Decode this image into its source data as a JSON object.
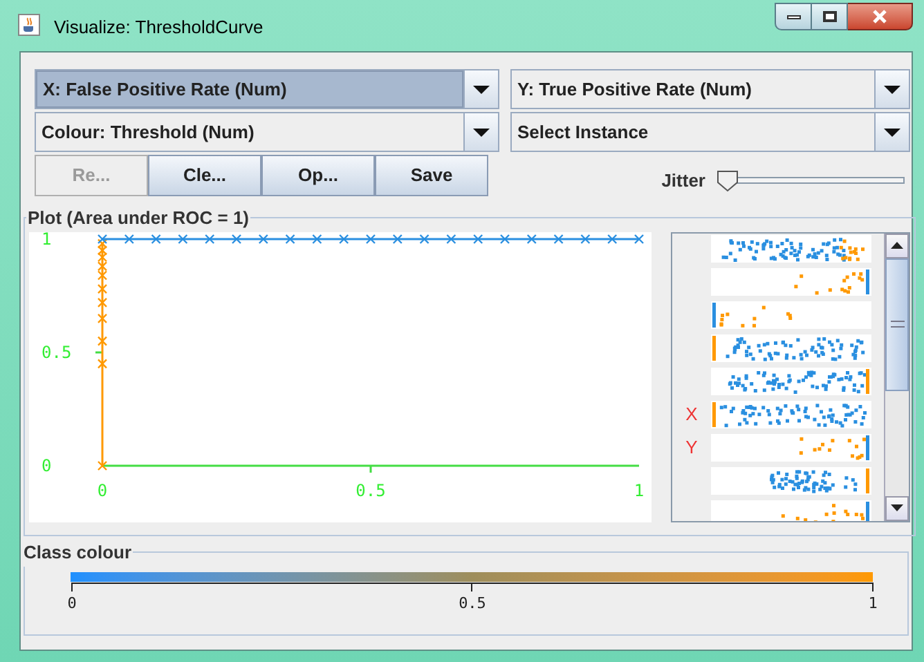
{
  "window": {
    "title": "Visualize: ThresholdCurve"
  },
  "selectors": [
    {
      "label": "X: False Positive Rate (Num)",
      "highlighted": true
    },
    {
      "label": "Y: True Positive Rate (Num)",
      "highlighted": false
    },
    {
      "label": "Colour: Threshold (Num)",
      "highlighted": false
    },
    {
      "label": "Select Instance",
      "highlighted": false
    }
  ],
  "buttons": [
    {
      "label": "Re...",
      "disabled": true
    },
    {
      "label": "Cle...",
      "disabled": false
    },
    {
      "label": "Op...",
      "disabled": false
    },
    {
      "label": "Save",
      "disabled": false
    }
  ],
  "jitter": {
    "label": "Jitter",
    "level": 0
  },
  "plot": {
    "title": "Plot (Area under ROC = 1)",
    "chart_data": {
      "type": "scatter",
      "x": [
        0,
        0,
        0,
        0,
        0,
        0,
        0,
        0,
        0,
        0,
        0,
        0,
        0.05,
        0.1,
        0.15,
        0.2,
        0.25,
        0.3,
        0.35,
        0.4,
        0.45,
        0.5,
        0.55,
        0.6,
        0.65,
        0.7,
        0.75,
        0.8,
        0.85,
        0.9,
        0.95,
        1
      ],
      "series": [
        {
          "color": "#ff9900",
          "values": [
            0,
            0.45,
            0.55,
            0.65,
            0.72,
            0.78,
            0.84,
            0.88,
            0.92,
            0.95,
            0.98,
            null,
            null,
            null,
            null,
            null,
            null,
            null,
            null,
            null,
            null,
            null,
            null,
            null,
            null,
            null,
            null,
            null,
            null,
            null,
            null,
            null
          ]
        },
        {
          "color": "#2a8fe0",
          "values": [
            null,
            null,
            null,
            null,
            null,
            null,
            null,
            null,
            null,
            null,
            null,
            1,
            1,
            1,
            1,
            1,
            1,
            1,
            1,
            1,
            1,
            1,
            1,
            1,
            1,
            1,
            1,
            1,
            1,
            1,
            1,
            1
          ]
        }
      ],
      "xlim": [
        0,
        1
      ],
      "ylim": [
        0,
        1
      ],
      "xticks": [
        {
          "value": 0,
          "label": "0"
        },
        {
          "value": 0.5,
          "label": "0.5"
        },
        {
          "value": 1,
          "label": "1"
        }
      ],
      "yticks": [
        {
          "value": 0,
          "label": "0"
        },
        {
          "value": 0.5,
          "label": "0.5"
        },
        {
          "value": 1,
          "label": "1"
        }
      ]
    }
  },
  "attribute_strips": [
    {
      "kind": "dense_mixed"
    },
    {
      "kind": "sparse_right",
      "bar_at_left": false,
      "color": "#2a8fe0"
    },
    {
      "kind": "sparse_left",
      "bar_at_left": true,
      "color": "#2a8fe0"
    },
    {
      "kind": "dense",
      "bar_at_left": true,
      "color": "#ff9900"
    },
    {
      "kind": "dense",
      "bar_at_left": false,
      "color": "#ff9900"
    },
    {
      "kind": "dense",
      "bar_at_left": true,
      "color": "#ff9900",
      "marker": "X"
    },
    {
      "kind": "sparse_right",
      "bar_at_left": false,
      "color": "#2a8fe0",
      "marker": "Y"
    },
    {
      "kind": "cluster",
      "bar_at_left": false,
      "color": "#ff9900"
    },
    {
      "kind": "sparse_right",
      "bar_at_left": false,
      "color": "#2a8fe0"
    }
  ],
  "class_colour": {
    "title": "Class colour",
    "ticks": [
      "0",
      "0.5",
      "1"
    ]
  }
}
